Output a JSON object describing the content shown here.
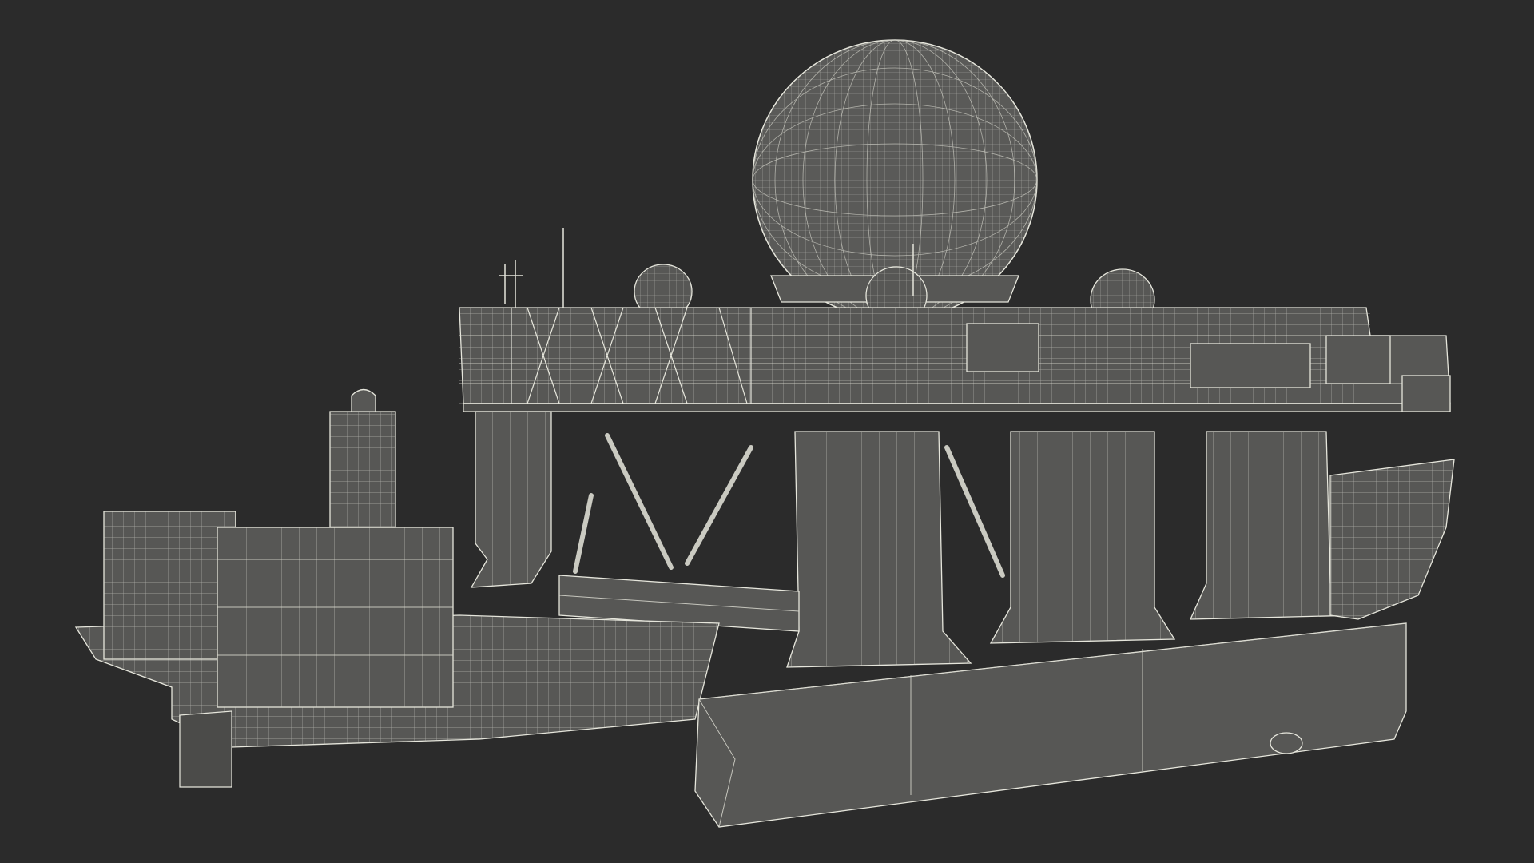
{
  "scene": {
    "background_color": "#2b2b2b",
    "wire_color": "#e6e6dc",
    "surface_color": "#575755",
    "subject": "wireframe-3d-model-sea-based-radar-platform"
  }
}
